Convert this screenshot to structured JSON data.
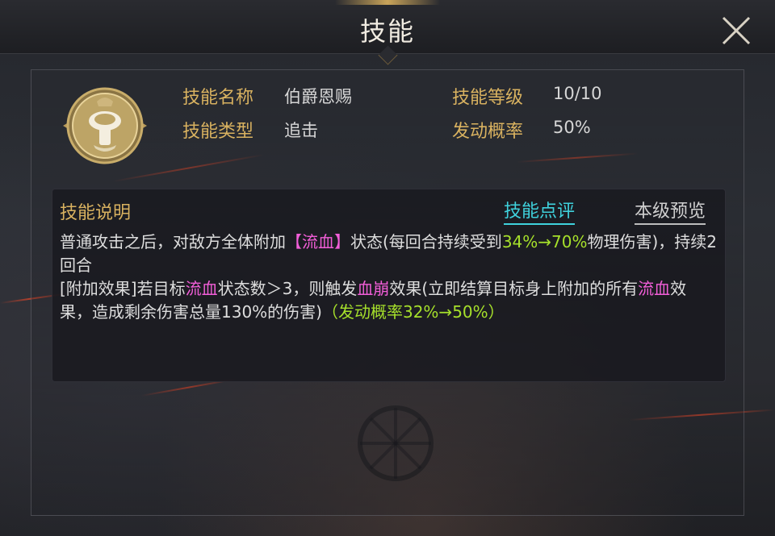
{
  "header": {
    "title": "技能"
  },
  "colors": {
    "accent_gold": "#d9b260",
    "tab_active": "#3fd2dd",
    "highlight_pink": "#f25ed8",
    "highlight_green": "#a6e02b"
  },
  "skill": {
    "icon": "bell-crest-icon",
    "name_label": "技能名称",
    "name_value": "伯爵恩赐",
    "type_label": "技能类型",
    "type_value": "追击",
    "level_label": "技能等级",
    "level_value": "10/10",
    "chance_label": "发动概率",
    "chance_value": "50%"
  },
  "description": {
    "title": "技能说明",
    "tabs": {
      "review": "技能点评",
      "preview": "本级预览"
    },
    "p1": {
      "t1": "普通攻击之后，对敌方全体附加",
      "t2": "【流血】",
      "t3": "状态(每回合持续受到",
      "t4": "34%→70%",
      "t5": "物理伤害)，持续2回合"
    },
    "p2": {
      "t1": "[附加效果]若目标",
      "t2": "流血",
      "t3": "状态数＞3，则触发",
      "t4": "血崩",
      "t5": "效果(立即结算目标身上附加的所有",
      "t6": "流血",
      "t7": "效果，造成剩余伤害总量130%的伤害)",
      "t8": "（发动概率32%→50%）"
    }
  }
}
